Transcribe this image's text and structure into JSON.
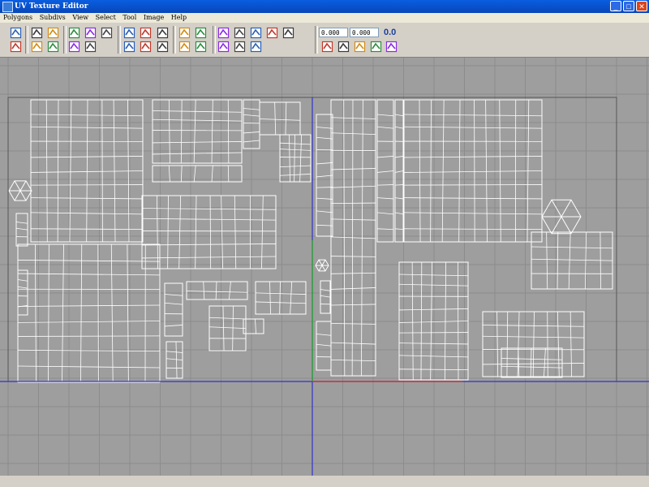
{
  "window": {
    "title": "UV Texture Editor"
  },
  "window_buttons": {
    "minimize": "_",
    "maximize": "□",
    "close": "✕"
  },
  "menu": [
    {
      "label": "Polygons"
    },
    {
      "label": "Subdivs"
    },
    {
      "label": "View"
    },
    {
      "label": "Select"
    },
    {
      "label": "Tool"
    },
    {
      "label": "Image"
    },
    {
      "label": "Help"
    }
  ],
  "toolbar": {
    "u_value": "0.000",
    "v_value": "0.000",
    "zero_label": "0.0",
    "icons": [
      "checker-icon",
      "display-image-icon",
      "rotate-cw-icon",
      "flip-icon",
      "cut-uv-icon",
      "sew-uv-icon",
      "move-sew-icon",
      "align-left-icon",
      "align-right-icon",
      "align-bottom-icon",
      "grid-icon",
      "snapshot-icon",
      "portrait-icon",
      "paint-icon",
      "layout-icon",
      "uv-lattice-icon",
      "person-icon",
      "rotate-ccw-icon",
      "rotate-90-icon",
      "relax-icon",
      "unfold-icon",
      "align-top-icon",
      "grid-split-icon",
      "grid-red-icon",
      "flatten-icon",
      "percent-icon",
      "shading-icon",
      "color-icon",
      "texture-tile-icon",
      "copy-icon",
      "paste-icon",
      "split-icon",
      "shelf-icon",
      "uv-percent-icon"
    ]
  },
  "colors": {
    "viewport_bg": "#9e9e9e",
    "grid_line": "#8c8c8c",
    "wire": "#ffffff",
    "u_axis": "#3333cc",
    "v_axis_pos": "#22aa22",
    "axis_red": "#d03030",
    "titlebar": "#0a5ee0"
  }
}
